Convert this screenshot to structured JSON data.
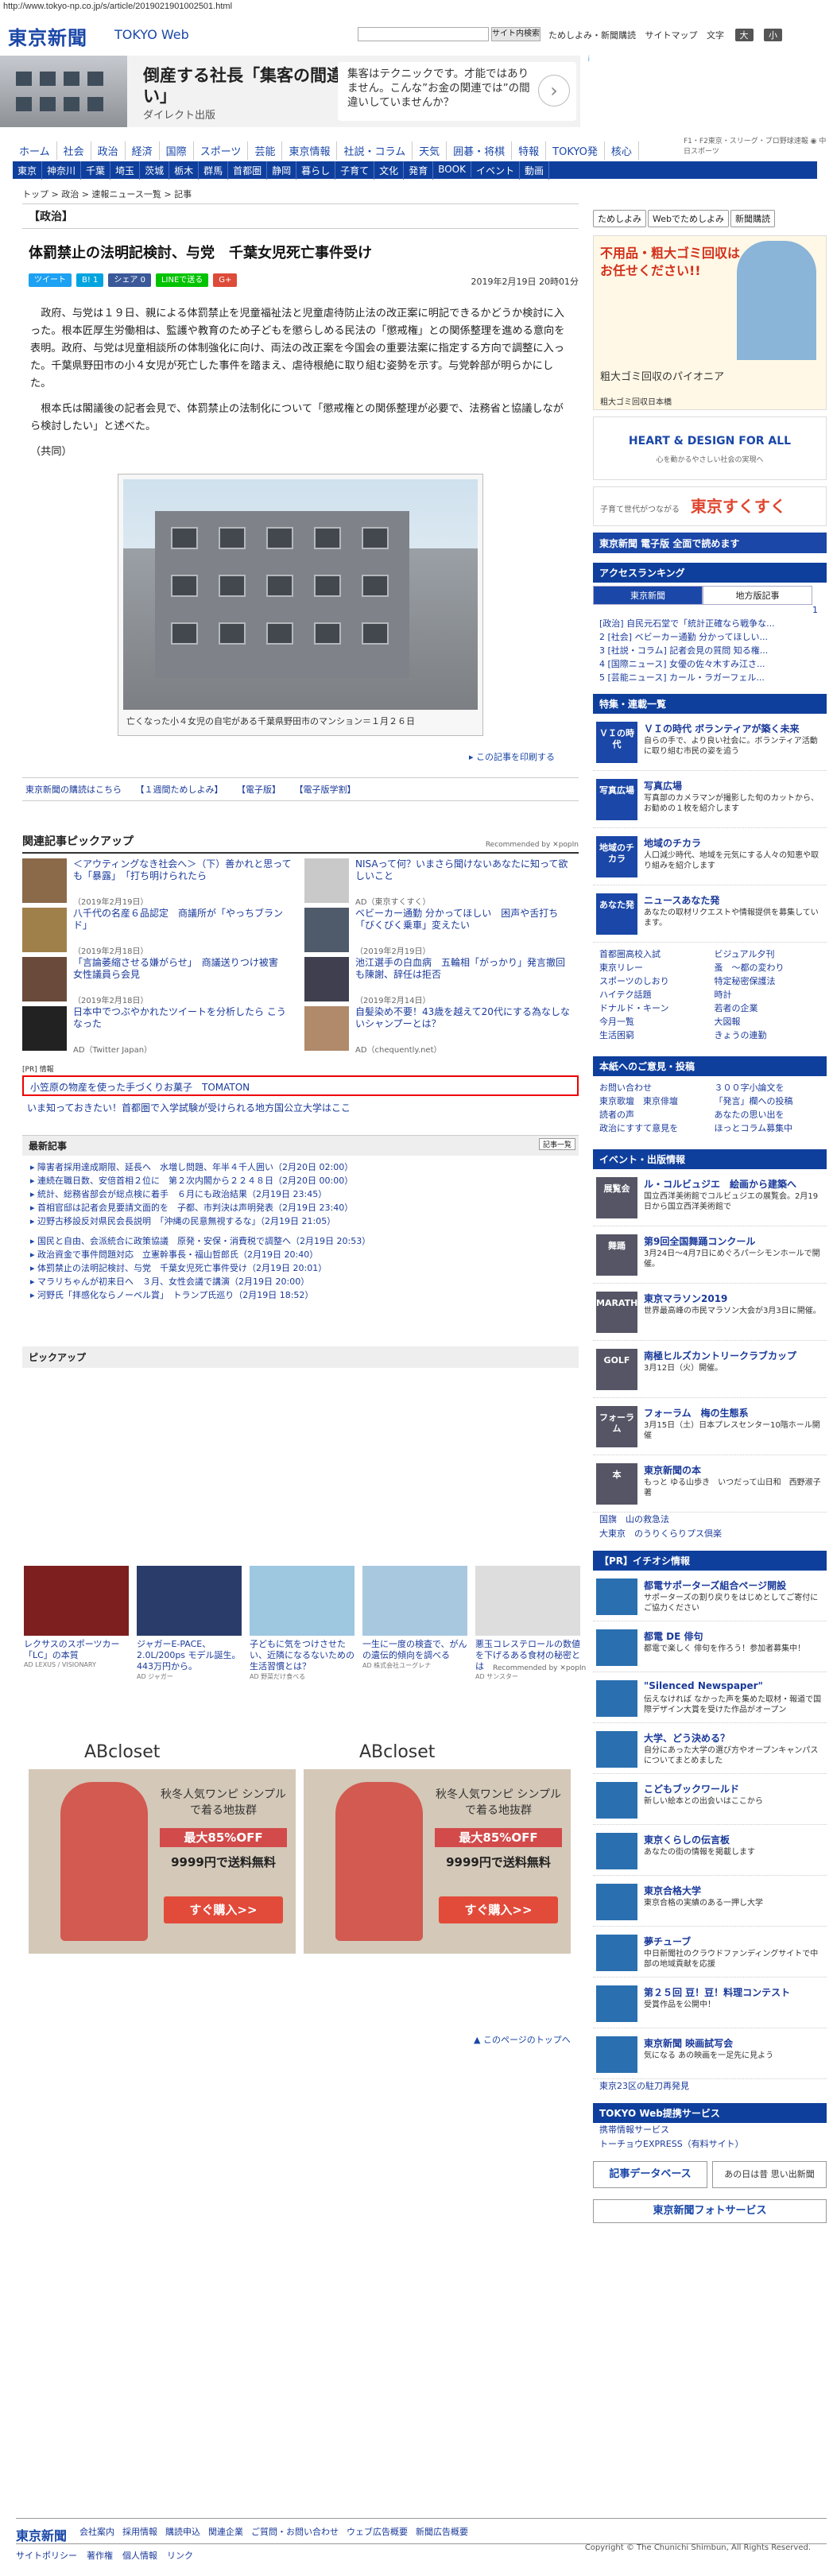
{
  "page_url": "http://www.tokyo-np.co.jp/s/article/2019021901002501.html",
  "header": {
    "logo": "東京新聞",
    "logo_sub": "TOKYO Web",
    "search_btn": "サイト内検索",
    "links": [
      "ためしよみ・新聞購読",
      "サイトマップ"
    ],
    "font_label": "文字",
    "font_large": "大",
    "font_small": "小"
  },
  "ad_top": {
    "title": "倒産する社長「集客の間違い」",
    "sub": "ダイレクト出版",
    "right": "集客はテクニックです。才能ではありません。こんな”お金の関連では”の間違いしていませんか？",
    "arrow": "›",
    "info": "i"
  },
  "nav1": [
    "ホーム",
    "社会",
    "政治",
    "経済",
    "国際",
    "スポーツ",
    "芸能",
    "東京情報",
    "社説・コラム",
    "天気",
    "囲碁・将棋",
    "特報",
    "TOKYO発",
    "核心"
  ],
  "nav1_right": "F1・F2東京・スリーグ・プロ野球速報 ◉ 中日スポーツ",
  "nav2": [
    "東京",
    "神奈川",
    "千葉",
    "埼玉",
    "茨城",
    "栃木",
    "群馬",
    "首都圏",
    "静岡",
    "暮らし",
    "子育て",
    "文化",
    "発育",
    "BOOK",
    "イベント",
    "動画"
  ],
  "breadcrumb": "トップ > 政治 > 速報ニュース一覧 > 記事",
  "article": {
    "section": "【政治】",
    "title": "体罰禁止の法明記検討、与党　千葉女児死亡事件受け",
    "date": "2019年2月19日 20時01分",
    "share": [
      "ツイート",
      "B! 1",
      "シェア 0",
      "LINEで送る",
      "G+"
    ],
    "paragraphs": [
      "政府、与党は１９日、親による体罰禁止を児童福祉法と児童虐待防止法の改正案に明記できるかどうか検討に入った。根本匠厚生労働相は、監護や教育のため子どもを懲らしめる民法の「懲戒権」との関係整理を進める意向を表明。政府、与党は児童相談所の体制強化に向け、両法の改正案を今国会の重要法案に指定する方向で調整に入った。千葉県野田市の小４女児が死亡した事件を踏まえ、虐待根絶に取り組む姿勢を示す。与党幹部が明らかにした。",
      "根本氏は閣議後の記者会見で、体罰禁止の法制化について「懲戒権との関係整理が必要で、法務省と協議しながら検討したい」と述べた。"
    ],
    "credit": "（共同）",
    "caption": "亡くなった小４女児の自宅がある千葉県野田市のマンション＝１月２６日",
    "print": "この記事を印刷する",
    "subs": [
      "東京新聞の購読はこちら",
      "【１週間ためしよみ】",
      "【電子版】",
      "【電子版学割】"
    ]
  },
  "pickup": {
    "title": "関連記事ピックアップ",
    "rec": "Recommended by ✕popIn",
    "items": [
      {
        "t": "＜アウティングなき社会へ＞（下）善かれと思っても「暴露」　「打ち明けられたら",
        "d": "（2019年2月19日）",
        "c": "#8b6a4a"
      },
      {
        "t": "NISAって何？いまさら聞けないあなたに知って欲しいこと",
        "d": "AD（東京すくすく）",
        "c": "#c9c9c9"
      },
      {
        "t": "八千代の名産６品認定　商議所が「やっちブランド」",
        "d": "（2019年2月18日）",
        "c": "#a0804a"
      },
      {
        "t": "ベビーカー通勤 分かってほしい　困声や舌打ち「びくびく乗車」変えたい",
        "d": "（2019年2月19日）",
        "c": "#4f5a6a"
      },
      {
        "t": "「言論萎縮させる嫌がらせ」　商議送りつけ被害　女性議員ら会見",
        "d": "（2019年2月18日）",
        "c": "#6a4a3a"
      },
      {
        "t": "池江選手の白血病　五輪相「がっかり」発言撤回も陳謝、辞任は拒否",
        "d": "（2019年2月14日）",
        "c": "#3f3f4f"
      },
      {
        "t": "日本中でつぶやかれたツイートを分析したら こうなった",
        "d": "AD（Twitter Japan）",
        "c": "#222"
      },
      {
        "t": "自髪染め不要！43歳を越えて20代にする為なしないシャンプーとは？",
        "d": "AD（chequently.net）",
        "c": "#b08a6a"
      }
    ]
  },
  "pr": {
    "label": "[PR] 情報",
    "link1": "小笠原の物産を使った手づくりお菓子　TOMATON",
    "link2": "いま知っておきたい！首都圏で入学試験が受けられる地方国公立大学はここ"
  },
  "latest": {
    "title": "最新記事",
    "more": "記事一覧",
    "items": [
      "障害者採用達成期限、延長へ　水増し問題、年半４千人囲い（2月20日 02:00）",
      "連続在職日数、安倍首相２位に　第２次内閣から２２４８日（2月20日 00:00）",
      "統計、総務省部会が総点検に着手　６月にも政治結果（2月19日 23:45）",
      "首相官邸は記者会見要請文面的を　子都、市判決は声明発表（2月19日 23:40）",
      "辺野古移設反対県民会長説明　「沖縄の民意無視するな」（2月19日 21:05）",
      "国民と自由、会派統合に政策協議　原発・安保・消費税で調整へ（2月19日 20:53）",
      "政治資金で事件問題対応　立憲幹事長・福山哲郎氏（2月19日 20:40）",
      "体罰禁止の法明記検討、与党　千葉女児死亡事件受け（2月19日 20:01）",
      "マラリちゃんが初来日へ　３月、女性会議で講演（2月19日 20:00）",
      "河野氏「拝感化ならノーベル賞」　トランプ氏巡り（2月19日 18:52）"
    ]
  },
  "bigpick": {
    "title": "ピックアップ",
    "items": [
      {
        "t": "レクサスのスポーツカー「LC」の本質",
        "s": "AD LEXUS / VISIONARY",
        "c": "#7d1f1f"
      },
      {
        "t": "ジャガーE-PACE、2.0L/200ps モデル誕生。443万円から。",
        "s": "AD ジャガー",
        "c": "#2a3c6a"
      },
      {
        "t": "子どもに気をつけさせたい、近隣になるないための生活習慣とは？",
        "s": "AD 野菜だけ食べる",
        "c": "#9ec7e0"
      },
      {
        "t": "一生に一度の検査で、がんの遺伝的傾向を調べる",
        "s": "AD 株式会社ユーグレナ",
        "c": "#a8c8e0"
      },
      {
        "t": "悪玉コレステロールの数値を下げるある食材の秘密とは",
        "s": "AD サンスター",
        "c": "#ddd"
      }
    ],
    "rec": "Recommended by ✕popIn"
  },
  "abc_ad": {
    "logo": "ABcloset",
    "line1": "秋冬人気ワンピ\nシンプルで着る地抜群",
    "discount": "最大85%OFF",
    "price": "9999円で送料無料",
    "btn": "すぐ購入>>"
  },
  "totop": "このページのトップへ",
  "side": {
    "btns": [
      "ためしよみ",
      "Webでためしよみ",
      "新聞購読"
    ],
    "ad1": {
      "title": "不用品・粗大ゴミ回収は",
      "sub": "お任せください!!",
      "co": "粗大ゴミ回収のパイオニア",
      "co2": "粗大ゴミ回収日本橋"
    },
    "heart": "HEART & DESIGN FOR ALL",
    "heart_sub": "心を動かるやさしい社会の実現へ",
    "sukusuku": "東京すくすく",
    "sukusuku_sub": "子育て世代がつながる",
    "denshi": "東京新聞 電子版 全面で読めます",
    "ranking_title": "アクセスランキング",
    "rank_tabs": [
      "東京新聞",
      "地方版記事"
    ],
    "ranks": [
      "1 [政治] 自民元石堂で「統計正確なら戦争な...",
      "2 [社会] ベビーカー通勤 分かってほしい...",
      "3 [社説・コラム] 記者会見の質問 知る権...",
      "4 [国際ニュース] 女優の佐々木すみ江さ...",
      "5 [芸能ニュース] カール・ラガーフェル..."
    ],
    "special_title": "特集・連載一覧",
    "features": [
      {
        "h": "ＶＩの時代 ボランティアが築く未来",
        "d": "自らの手で、より良い社会に。ボランティア活動に取り組む市民の姿を追う",
        "ic": "ＶＩの時代"
      },
      {
        "h": "写真広場",
        "d": "写真部のカメラマンが撮影した旬のカットから、お勧めの１枚を紹介します",
        "ic": "写真広場"
      },
      {
        "h": "地域のチカラ",
        "d": "人口減少時代、地域を元気にする人々の知恵や取り組みを紹介します",
        "ic": "地域のチカラ"
      },
      {
        "h": "ニュースあなた発",
        "d": "あなたの取材リクエストや情報提供を募集しています。",
        "ic": "あなた発"
      }
    ],
    "topics": [
      "首都圏高校入試",
      "東京リレー",
      "スポーツのしおり",
      "ハイテク話題",
      "ドナルド・キーン",
      "今月一覧",
      "生活困窮",
      "ビジュアル夕刊",
      "蚤　～都の変わり",
      "特定秘密保護法",
      "時計",
      "若者の企業",
      "大図報",
      "きょうの連勤"
    ],
    "ask_title": "本紙へのご意見・投稿",
    "ask": [
      "お問い合わせ",
      "東京歌壇　東京俳壇",
      "読者の声",
      "政治にすすて意見を",
      "３００字小論文を",
      "「発言」欄への投稿",
      "あなたの思い出を",
      "ほっとコラム募集中"
    ],
    "event_title": "イベント・出版情報",
    "events": [
      {
        "h": "ル・コルビュジエ　絵画から建築へ",
        "d": "国立西洋美術館でコルビュジエの展覧会。2月19日から国立西洋美術館で",
        "ic": "展覧会"
      },
      {
        "h": "第9回全国舞踊コンクール",
        "d": "3月24日～4月7日にめぐろパーシモンホールで開催。",
        "ic": "舞踊"
      },
      {
        "h": "東京マラソン2019",
        "d": "世界最高峰の市民マラソン大会が3月3日に開催。",
        "ic": "MARATHON"
      },
      {
        "h": "南極ヒルズカントリークラブカップ",
        "d": "3月12日（火）開催。",
        "ic": "GOLF"
      },
      {
        "h": "フォーラム　梅の生態系",
        "d": "3月15日（土）日本プレスセンター10階ホール開催",
        "ic": "フォーラム"
      },
      {
        "h": "東京新聞の本",
        "d": "もっと ゆる山歩き　いつだって山日和　西野淑子 著",
        "ic": "本"
      }
    ],
    "mini_links": [
      "国旗　山の救急法",
      "大東京　のうりくらりプス倶楽"
    ],
    "pr_title": "【PR】イチオシ情報",
    "prs": [
      {
        "h": "都電サポーターズ組合ページ開設",
        "d": "サポーターズの割り戻りをはじめとしてご寄付にご協力ください"
      },
      {
        "h": "都電 DE 俳句",
        "d": "都電で楽しく 俳句を作ろう！参加者募集中！"
      },
      {
        "h": "\"Silenced Newspaper\"",
        "d": "伝えなければ なかった声を集めた取材・報道で国際デザイン大賞を受けた作品がオープン"
      },
      {
        "h": "大学、どう決める？",
        "d": "自分にあった大学の選び方やオープンキャンパスについてまとめました"
      },
      {
        "h": "こどもブックワールド",
        "d": "新しい絵本との出会いはここから"
      },
      {
        "h": "東京くらしの伝言板",
        "d": "あなたの街の情報を掲載します"
      },
      {
        "h": "東京合格大学",
        "d": "東京合格の実績のある一押し大学"
      },
      {
        "h": "夢チューブ",
        "d": "中日新聞社のクラウドファンディングサイトで中部の地域貢献を応援"
      },
      {
        "h": "第２５回 豆！豆！料理コンテスト",
        "d": "受賞作品を公開中！"
      },
      {
        "h": "東京新聞 映画試写会",
        "d": "気になる あの映画を一足先に見よう"
      }
    ],
    "bottom_links": [
      "東京23区の駐刀再発見"
    ],
    "web_title": "TOKYO Web提携サービス",
    "web": [
      "携帯情報サービス",
      "トーチョウEXPRESS（有料サイト）"
    ],
    "db": "記事データベース",
    "bd": "あの日は昔 思い出新聞",
    "photo_svc": "東京新聞フォトサービス"
  },
  "footer": {
    "logo": "東京新聞",
    "links": [
      "会社案内",
      "採用情報",
      "購読申込",
      "関連企業",
      "ご質問・お問い合わせ",
      "ウェブ広告概要",
      "新聞広告概要"
    ],
    "bottom": [
      "サイトポリシー",
      "著作権",
      "個人情報",
      "リンク"
    ],
    "copy": "Copyright © The Chunichi Shimbun, All Rights Reserved."
  }
}
